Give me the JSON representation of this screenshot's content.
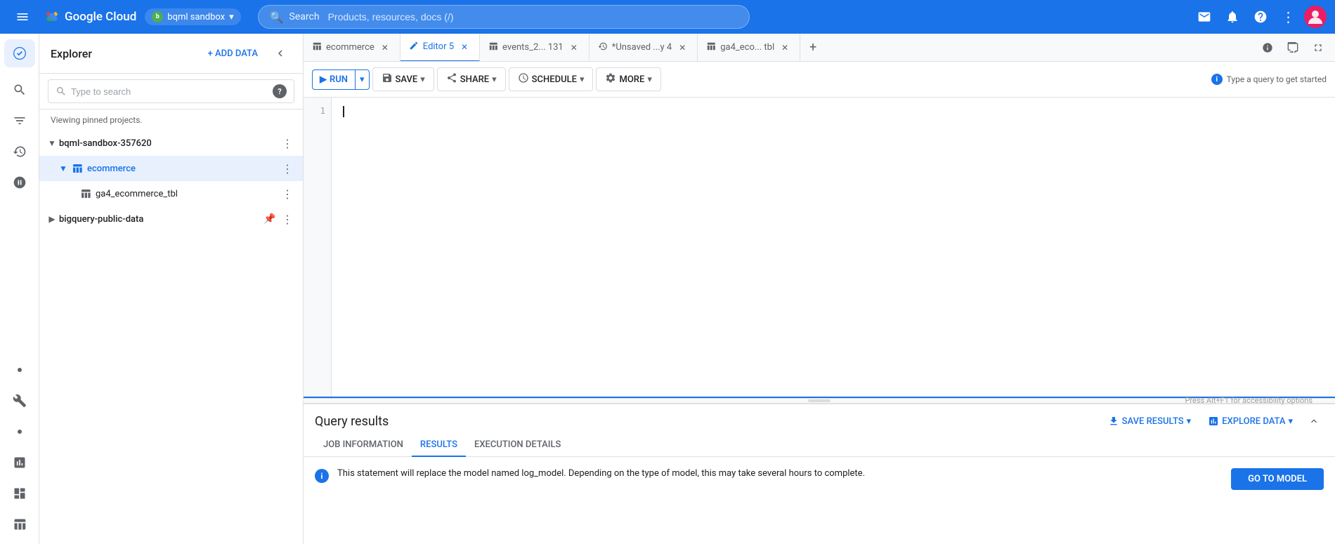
{
  "topNav": {
    "hamburger_label": "☰",
    "logo_text": "Google Cloud",
    "project_name": "bqml sandbox",
    "search_placeholder": "Products, resources, docs (/)",
    "search_label": "Search"
  },
  "explorer": {
    "title": "Explorer",
    "add_data_label": "+ ADD DATA",
    "search_placeholder": "Type to search",
    "pinned_text": "Viewing pinned projects.",
    "tree": [
      {
        "id": "bqml-sandbox",
        "label": "bqml-sandbox-357620",
        "level": 0,
        "expanded": true,
        "icon": "▼",
        "has_more": true
      },
      {
        "id": "ecommerce",
        "label": "ecommerce",
        "level": 1,
        "expanded": true,
        "icon": "▼",
        "selected": true,
        "has_more": true,
        "table_icon": true
      },
      {
        "id": "ga4_ecommerce_tbl",
        "label": "ga4_ecommerce_tbl",
        "level": 2,
        "icon": "",
        "has_more": true,
        "table_icon": true
      },
      {
        "id": "bigquery-public-data",
        "label": "bigquery-public-data",
        "level": 0,
        "expanded": false,
        "icon": "▶",
        "has_more": true,
        "pinned": true
      }
    ]
  },
  "tabs": [
    {
      "id": "ecommerce",
      "label": "ecommerce",
      "icon": "table",
      "active": false,
      "closeable": true
    },
    {
      "id": "editor5",
      "label": "Editor 5",
      "icon": "edit",
      "active": true,
      "closeable": true
    },
    {
      "id": "events2",
      "label": "events_2... 131",
      "icon": "table",
      "active": false,
      "closeable": true
    },
    {
      "id": "unsaved",
      "label": "*Unsaved ...y 4",
      "icon": "clock",
      "active": false,
      "closeable": true
    },
    {
      "id": "ga4eco",
      "label": "ga4_eco... tbl",
      "icon": "table",
      "active": false,
      "closeable": true
    }
  ],
  "toolbar": {
    "run_label": "RUN",
    "save_label": "SAVE",
    "share_label": "SHARE",
    "schedule_label": "SCHEDULE",
    "more_label": "MORE",
    "hint_text": "Type a query to get started"
  },
  "editor": {
    "line_numbers": [
      "1"
    ],
    "cursor_line": 1
  },
  "results": {
    "title": "Query results",
    "save_results_label": "SAVE RESULTS",
    "explore_data_label": "EXPLORE DATA",
    "tabs": [
      {
        "id": "job-info",
        "label": "JOB INFORMATION",
        "active": false
      },
      {
        "id": "results",
        "label": "RESULTS",
        "active": true
      },
      {
        "id": "execution",
        "label": "EXECUTION DETAILS",
        "active": false
      }
    ],
    "message": "This statement will replace the model named log_model. Depending on the type of model, this may take several hours to complete.",
    "go_to_model_label": "GO TO MODEL"
  },
  "accessibility": {
    "hint": "Press Alt+F1 for accessibility options"
  }
}
